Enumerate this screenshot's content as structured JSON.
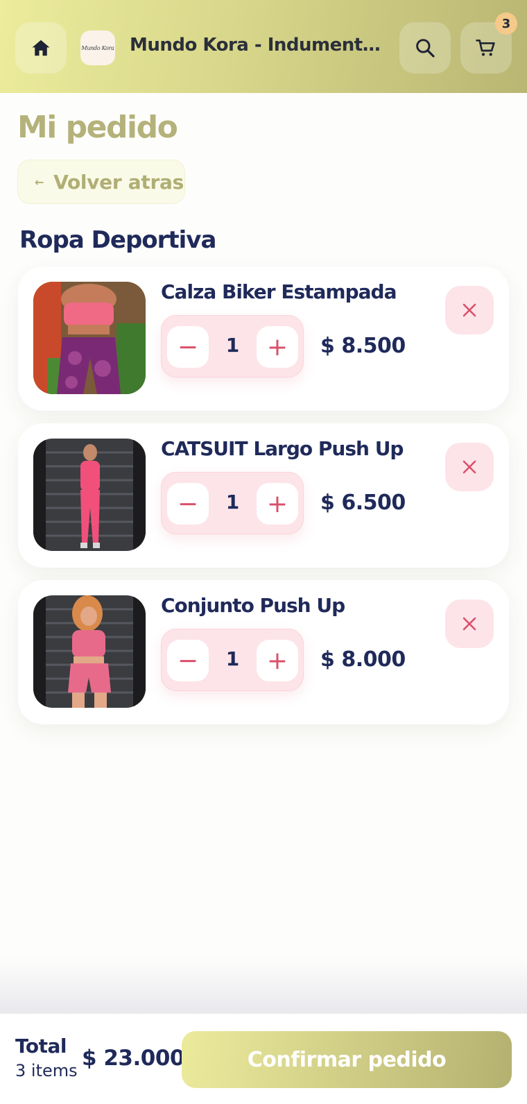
{
  "header": {
    "store_name": "Mundo Kora - Indumentaria...",
    "logo_text": "Mundo Kora",
    "cart_count": "3"
  },
  "page": {
    "title": "Mi pedido",
    "back_label": "Volver atras",
    "back_arrow": "←",
    "section_title": "Ropa Deportiva"
  },
  "items": [
    {
      "name": "Calza Biker Estampada",
      "qty": "1",
      "price": "$ 8.500",
      "minus": "−",
      "plus": "+"
    },
    {
      "name": "CATSUIT Largo Push Up",
      "qty": "1",
      "price": "$ 6.500",
      "minus": "−",
      "plus": "+"
    },
    {
      "name": "Conjunto Push Up",
      "qty": "1",
      "price": "$ 8.000",
      "minus": "−",
      "plus": "+"
    }
  ],
  "footer": {
    "total_label": "Total",
    "items_count": "3 items",
    "total_value": "$ 23.000",
    "confirm_label": "Confirmar pedido"
  },
  "colors": {
    "brand_gradient_start": "#ecec9c",
    "brand_gradient_end": "#b9b673",
    "accent_pink": "#d9506a",
    "text_navy": "#1f2a5a"
  },
  "icons": [
    "home-icon",
    "search-icon",
    "cart-icon",
    "close-icon",
    "minus-icon",
    "plus-icon",
    "arrow-left-icon"
  ]
}
